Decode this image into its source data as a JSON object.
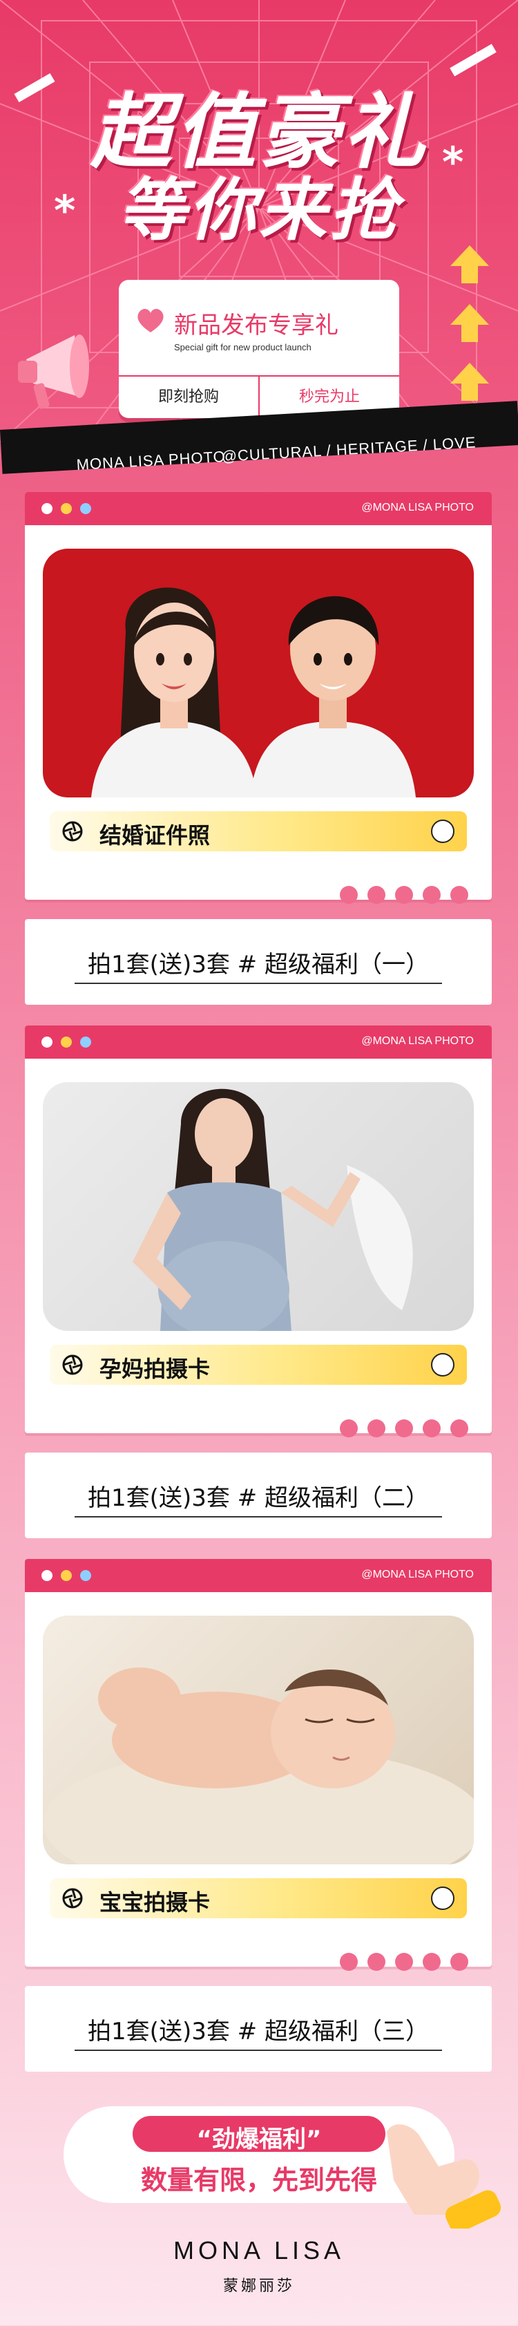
{
  "hero": {
    "title_line1": "超值豪礼",
    "title_line2": "等你来抢",
    "gift_card": {
      "title": "新品发布专享礼",
      "subtitle": "Special gift for new product launch",
      "button_grab": "即刻抢购",
      "button_soldout": "秒完为止"
    },
    "ribbon_left": "MONA LISA PHOTO",
    "ribbon_right": "@CULTURAL / HERITAGE / LOVE"
  },
  "panels": [
    {
      "tag": "@MONA LISA PHOTO",
      "label": "结婚证件照",
      "photo_icon": "couple-id-photo"
    },
    {
      "tag": "@MONA LISA PHOTO",
      "label": "孕妈拍摄卡",
      "photo_icon": "maternity-photo"
    },
    {
      "tag": "@MONA LISA PHOTO",
      "label": "宝宝拍摄卡",
      "photo_icon": "newborn-photo"
    }
  ],
  "benefits": [
    "拍1套(送)3套 # 超级福利（一）",
    "拍1套(送)3套 # 超级福利（二）",
    "拍1套(送)3套 # 超级福利（三）"
  ],
  "cta": {
    "pill": "“劲爆福利”",
    "text": "数量有限，先到先得"
  },
  "brand": {
    "name": "MONA LISA",
    "name_cn": "蒙娜丽莎"
  },
  "colors": {
    "accent": "#e83a67",
    "yellow": "#ffd24a",
    "dot_red": "#f7c0cf",
    "dot_yellow": "#ffd24a",
    "dot_blue": "#8ecfff"
  }
}
